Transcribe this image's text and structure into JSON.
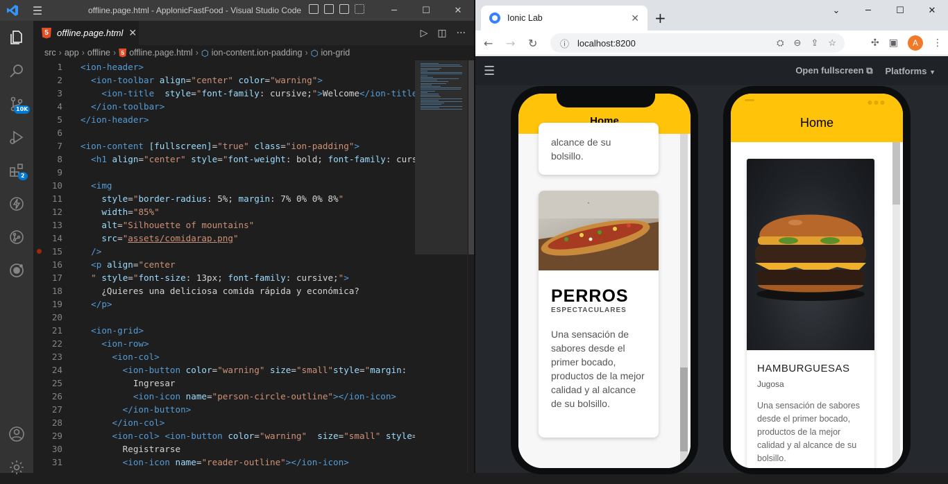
{
  "vscode": {
    "window_title": "offline.page.html - ApplonicFastFood - Visual Studio Code",
    "tab": {
      "label": "offline.page.html",
      "close": "✕"
    },
    "breadcrumb": [
      "src",
      "app",
      "offline",
      "offline.page.html",
      "ion-content.ion-padding",
      "ion-grid"
    ],
    "activity_badges": {
      "source_control": "10K",
      "extensions": "2"
    },
    "code_lines": [
      {
        "n": "1",
        "html": "<span class='t'>&lt;ion-header&gt;</span>"
      },
      {
        "n": "2",
        "html": "  <span class='t'>&lt;ion-toolbar</span> <span class='a'>align</span><span class='x'>=</span><span class='s'>\"center\"</span> <span class='a'>color</span><span class='x'>=</span><span class='s'>\"warning\"</span><span class='t'>&gt;</span>"
      },
      {
        "n": "3",
        "html": "    <span class='t'>&lt;ion-title</span>  <span class='a'>style</span><span class='x'>=</span><span class='s'>\"</span><span class='a'>font-family</span><span class='x'>: cursive;</span><span class='s'>\"</span><span class='t'>&gt;</span><span class='x'>Welcome</span><span class='t'>&lt;/ion-title&gt;</span>"
      },
      {
        "n": "4",
        "html": "  <span class='t'>&lt;/ion-toolbar&gt;</span>"
      },
      {
        "n": "5",
        "html": "<span class='t'>&lt;/ion-header&gt;</span>"
      },
      {
        "n": "6",
        "html": ""
      },
      {
        "n": "7",
        "html": "<span class='t'>&lt;ion-content</span> <span class='a'>[fullscreen]</span><span class='x'>=</span><span class='s'>\"true\"</span> <span class='a'>class</span><span class='x'>=</span><span class='s'>\"ion-padding\"</span><span class='t'>&gt;</span>"
      },
      {
        "n": "8",
        "html": "  <span class='t'>&lt;h1</span> <span class='a'>align</span><span class='x'>=</span><span class='s'>\"center\"</span> <span class='a'>style</span><span class='x'>=</span><span class='s'>\"</span><span class='a'>font-weight</span><span class='x'>: bold; </span><span class='a'>font-family</span><span class='x'>: cursive;</span>"
      },
      {
        "n": "9",
        "html": ""
      },
      {
        "n": "10",
        "html": "  <span class='t'>&lt;img</span>"
      },
      {
        "n": "11",
        "html": "    <span class='a'>style</span><span class='x'>=</span><span class='s'>\"</span><span class='a'>border-radius</span><span class='x'>: 5%; </span><span class='a'>margin</span><span class='x'>: 7% 0% 0% 8%</span><span class='s'>\"</span>"
      },
      {
        "n": "12",
        "html": "    <span class='a'>width</span><span class='x'>=</span><span class='s'>\"85%\"</span>"
      },
      {
        "n": "13",
        "html": "    <span class='a'>alt</span><span class='x'>=</span><span class='s'>\"Silhouette of mountains\"</span>"
      },
      {
        "n": "14",
        "html": "    <span class='a'>src</span><span class='x'>=</span><span class='s'>\"<span class='u'>assets/comidarap.png</span>\"</span>"
      },
      {
        "n": "15",
        "html": "  <span class='t'>/&gt;</span>",
        "bp": true
      },
      {
        "n": "16",
        "html": "  <span class='t'>&lt;p</span> <span class='a'>align</span><span class='x'>=</span><span class='s'>\"center</span>"
      },
      {
        "n": "17",
        "html": "  <span class='s'>\"</span> <span class='a'>style</span><span class='x'>=</span><span class='s'>\"</span><span class='a'>font-size</span><span class='x'>: 13px; </span><span class='a'>font-family</span><span class='x'>: cursive;</span><span class='s'>\"</span><span class='t'>&gt;</span>"
      },
      {
        "n": "18",
        "html": "    <span class='x'>¿Quieres una deliciosa comida rápida y económica?</span>"
      },
      {
        "n": "19",
        "html": "  <span class='t'>&lt;/p&gt;</span>"
      },
      {
        "n": "20",
        "html": ""
      },
      {
        "n": "21",
        "html": "  <span class='t'>&lt;ion-grid&gt;</span>"
      },
      {
        "n": "22",
        "html": "    <span class='t'>&lt;ion-row&gt;</span>"
      },
      {
        "n": "23",
        "html": "      <span class='t'>&lt;ion-col&gt;</span>"
      },
      {
        "n": "24",
        "html": "        <span class='t'>&lt;ion-button</span> <span class='a'>color</span><span class='x'>=</span><span class='s'>\"warning\"</span> <span class='a'>size</span><span class='x'>=</span><span class='s'>\"small\"</span><span class='a'>style</span><span class='x'>=</span><span class='s'>\"</span><span class='a'>margin</span><span class='x'>:</span>"
      },
      {
        "n": "25",
        "html": "          <span class='x'>Ingresar</span>"
      },
      {
        "n": "26",
        "html": "          <span class='t'>&lt;ion-icon</span> <span class='a'>name</span><span class='x'>=</span><span class='s'>\"person-circle-outline\"</span><span class='t'>&gt;&lt;/ion-icon&gt;</span>"
      },
      {
        "n": "27",
        "html": "        <span class='t'>&lt;/ion-button&gt;</span>"
      },
      {
        "n": "28",
        "html": "      <span class='t'>&lt;/ion-col&gt;</span>"
      },
      {
        "n": "29",
        "html": "      <span class='t'>&lt;ion-col&gt;</span> <span class='t'>&lt;ion-button</span> <span class='a'>color</span><span class='x'>=</span><span class='s'>\"warning\"</span>  <span class='a'>size</span><span class='x'>=</span><span class='s'>\"small\"</span> <span class='a'>style</span><span class='x'>=</span>"
      },
      {
        "n": "30",
        "html": "        <span class='x'>Registrarse</span>"
      },
      {
        "n": "31",
        "html": "        <span class='t'>&lt;ion-icon</span> <span class='a'>name</span><span class='x'>=</span><span class='s'>\"reader-outline\"</span><span class='t'>&gt;&lt;/ion-icon&gt;</span>"
      }
    ]
  },
  "browser": {
    "tab_title": "Ionic Lab",
    "url": "localhost:8200",
    "avatar_letter": "A",
    "lab_links": {
      "fullscreen": "Open fullscreen",
      "platforms": "Platforms"
    }
  },
  "ios_phone": {
    "header": "Home",
    "card1_tail": "alcance de su\nbolsillo.",
    "card2": {
      "title": "PERROS",
      "subtitle": "ESPECTACULARES",
      "text": "Una sensación de sabores desde el primer bocado, productos de la mejor calidad y al alcance de su bolsillo."
    }
  },
  "android_phone": {
    "header": "Home",
    "card": {
      "title": "HAMBURGUESAS",
      "subtitle": "Jugosa",
      "text": "Una sensación de sabores desde el primer bocado, productos de la mejor calidad y al alcance de su bolsillo."
    }
  },
  "colors": {
    "ionic_warning": "#ffc409",
    "vscode_accent": "#0078d4"
  }
}
